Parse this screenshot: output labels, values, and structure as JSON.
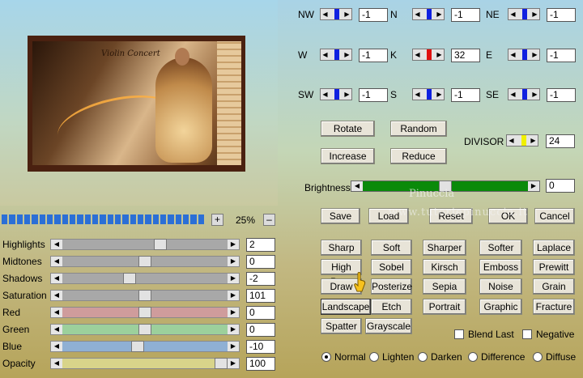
{
  "preview": {
    "title_text": "Violin Concert"
  },
  "zoom": {
    "plus_label": "+",
    "minus_label": "–",
    "value": "25%",
    "segments": 27
  },
  "adjust": {
    "rows": [
      {
        "label": "Highlights",
        "value": "2",
        "level": 0.6,
        "track_color": "#a8a8a8"
      },
      {
        "label": "Midtones",
        "value": "0",
        "level": 0.5,
        "track_color": "#a8a8a8"
      },
      {
        "label": "Shadows",
        "value": "-2",
        "level": 0.4,
        "track_color": "#a8a8a8"
      },
      {
        "label": "Saturation",
        "value": "101",
        "level": 0.5,
        "track_color": "#a8a8a8"
      },
      {
        "label": "Red",
        "value": "0",
        "level": 0.5,
        "track_color": "#cf9c9c"
      },
      {
        "label": "Green",
        "value": "0",
        "level": 0.5,
        "track_color": "#9cd09c"
      },
      {
        "label": "Blue",
        "value": "-10",
        "level": 0.45,
        "track_color": "#8fb0d4"
      },
      {
        "label": "Opacity",
        "value": "100",
        "level": 1.0,
        "track_color": "#d8d48a"
      }
    ]
  },
  "matrix": {
    "cells": [
      {
        "label": "NW",
        "value": "-1",
        "color": "#1020e0"
      },
      {
        "label": "N",
        "value": "-1",
        "color": "#1020e0"
      },
      {
        "label": "NE",
        "value": "-1",
        "color": "#1020e0"
      },
      {
        "label": "W",
        "value": "-1",
        "color": "#1020e0"
      },
      {
        "label": "K",
        "value": "32",
        "color": "#e01010"
      },
      {
        "label": "E",
        "value": "-1",
        "color": "#1020e0"
      },
      {
        "label": "SW",
        "value": "-1",
        "color": "#1020e0"
      },
      {
        "label": "S",
        "value": "-1",
        "color": "#1020e0"
      },
      {
        "label": "SE",
        "value": "-1",
        "color": "#1020e0"
      }
    ]
  },
  "matrix_buttons": {
    "rotate": "Rotate",
    "random": "Random",
    "increase": "Increase",
    "reduce": "Reduce"
  },
  "divisor": {
    "label": "DIVISOR",
    "value": "24",
    "color": "#f0f000"
  },
  "brightness": {
    "label": "Brightness",
    "value": "0",
    "level": 0.5,
    "track_color": "#0a8a0a"
  },
  "actions": {
    "save": "Save",
    "load": "Load",
    "reset": "Reset",
    "ok": "OK",
    "cancel": "Cancel"
  },
  "presets": [
    [
      "Sharp",
      "Soft",
      "Sharper",
      "Softer",
      "Laplace"
    ],
    [
      "High Pass",
      "Sobel",
      "Kirsch",
      "Emboss",
      "Prewitt"
    ],
    [
      "Draw",
      "Posterize",
      "Sepia",
      "Noise",
      "Grain"
    ],
    [
      "Landscape",
      "Etch",
      "Portrait",
      "Graphic",
      "Fracture"
    ],
    [
      "Spatter",
      "Grayscale"
    ]
  ],
  "options": {
    "blend_last": "Blend Last",
    "negative": "Negative"
  },
  "blend_modes": [
    "Normal",
    "Lighten",
    "Darken",
    "Difference",
    "Diffuse"
  ],
  "blend_selected": "Normal",
  "watermark": {
    "line1": "Pinuccia",
    "line2": "www.tutoriepinuccia.it"
  }
}
